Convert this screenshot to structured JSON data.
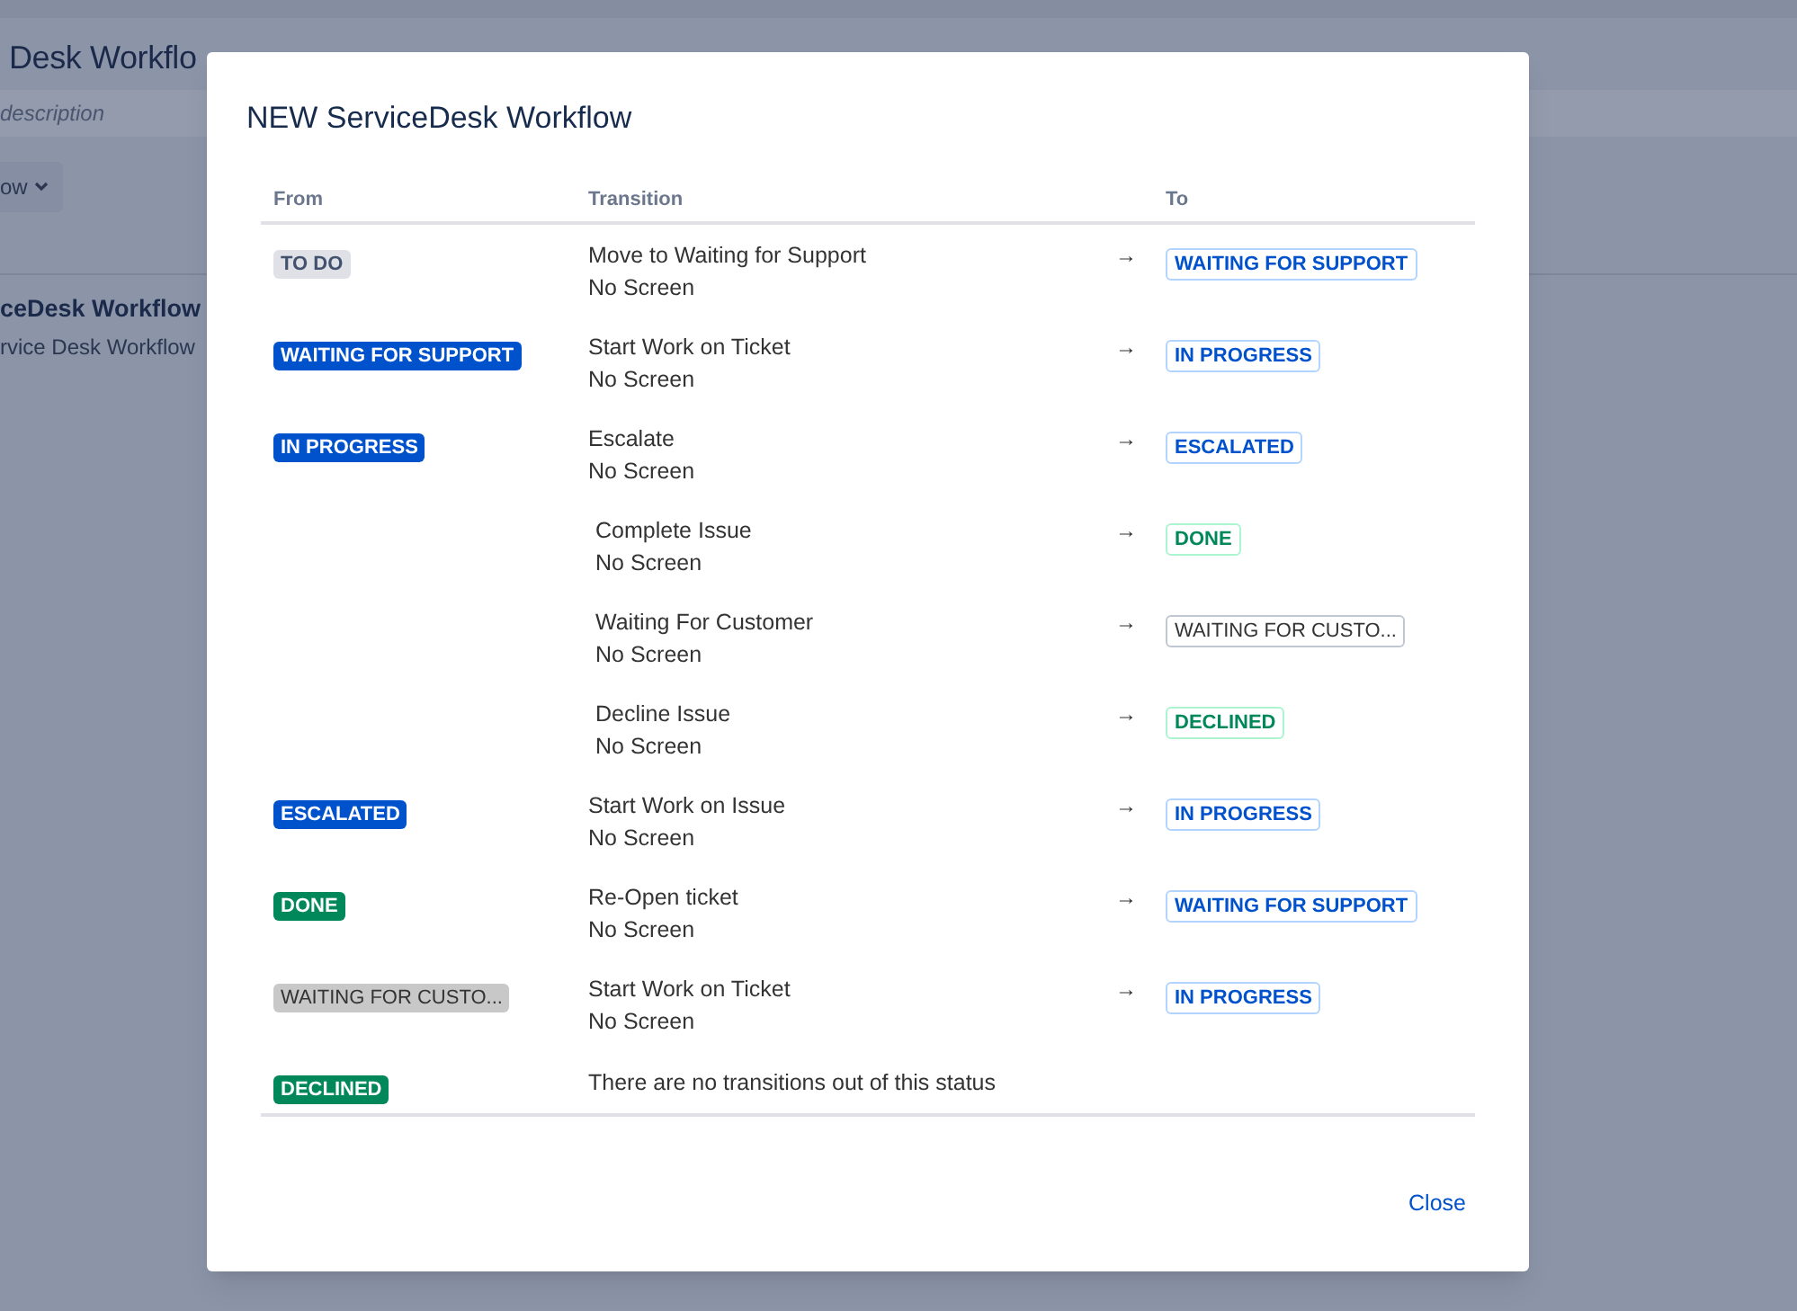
{
  "background_page": {
    "title": "Desk Workflo",
    "description": "description",
    "dropdown_button": "ow",
    "workflow_name": "ceDesk Workflow",
    "workflow_subtitle": "rvice Desk Workflow"
  },
  "dialog": {
    "title": "NEW ServiceDesk Workflow",
    "table": {
      "columns": [
        "From",
        "Transition",
        "To"
      ],
      "rows": [
        {
          "from": {
            "label": "TO DO",
            "kind": "todo"
          },
          "transitions": [
            {
              "name": "Move to Waiting for Support",
              "screen": "No Screen",
              "arrow": "→",
              "to": {
                "label": "WAITING FOR SUPPORT",
                "kind": "inprogress"
              }
            }
          ]
        },
        {
          "from": {
            "label": "WAITING FOR SUPPORT",
            "kind": "inprogress"
          },
          "transitions": [
            {
              "name": "Start Work on Ticket",
              "screen": "No Screen",
              "arrow": "→",
              "to": {
                "label": "IN PROGRESS",
                "kind": "inprogress"
              }
            }
          ]
        },
        {
          "from": {
            "label": "IN PROGRESS",
            "kind": "inprogress"
          },
          "transitions": [
            {
              "name": "Escalate",
              "screen": "No Screen",
              "arrow": "→",
              "to": {
                "label": "ESCALATED",
                "kind": "inprogress"
              }
            },
            {
              "name": "Complete Issue",
              "screen": "No Screen",
              "arrow": "→",
              "to": {
                "label": "DONE",
                "kind": "done"
              }
            },
            {
              "name": "Waiting For Customer",
              "screen": "No Screen",
              "arrow": "→",
              "to": {
                "label": "WAITING FOR CUSTO...",
                "kind": "other"
              }
            },
            {
              "name": "Decline Issue",
              "screen": "No Screen",
              "arrow": "→",
              "to": {
                "label": "DECLINED",
                "kind": "done"
              }
            }
          ]
        },
        {
          "from": {
            "label": "ESCALATED",
            "kind": "inprogress"
          },
          "transitions": [
            {
              "name": "Start Work on Issue",
              "screen": "No Screen",
              "arrow": "→",
              "to": {
                "label": "IN PROGRESS",
                "kind": "inprogress"
              }
            }
          ]
        },
        {
          "from": {
            "label": "DONE",
            "kind": "done"
          },
          "transitions": [
            {
              "name": "Re-Open ticket",
              "screen": "No Screen",
              "arrow": "→",
              "to": {
                "label": "WAITING FOR SUPPORT",
                "kind": "inprogress"
              }
            }
          ]
        },
        {
          "from": {
            "label": "WAITING FOR CUSTO...",
            "kind": "other"
          },
          "transitions": [
            {
              "name": "Start Work on Ticket",
              "screen": "No Screen",
              "arrow": "→",
              "to": {
                "label": "IN PROGRESS",
                "kind": "inprogress"
              }
            }
          ]
        },
        {
          "from": {
            "label": "DECLINED",
            "kind": "done"
          },
          "note": "There are no transitions out of this status"
        }
      ]
    },
    "close_link": "Close"
  }
}
